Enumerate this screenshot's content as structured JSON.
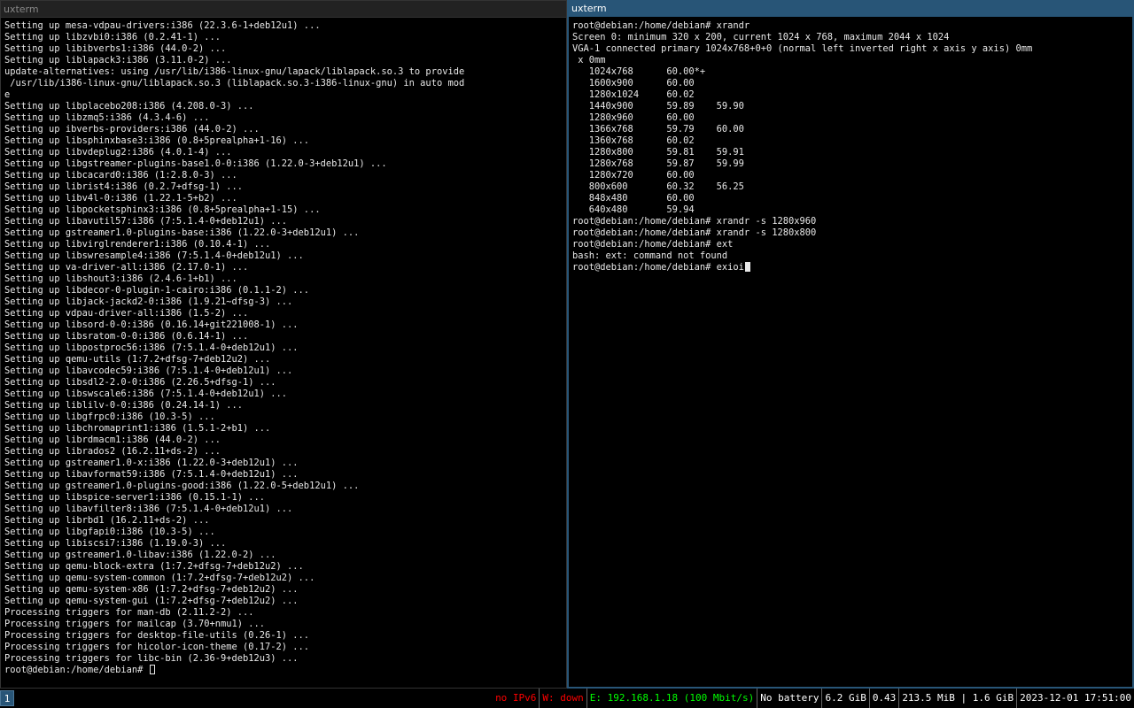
{
  "left_window": {
    "title": "uxterm",
    "lines": [
      "Setting up mesa-vdpau-drivers:i386 (22.3.6-1+deb12u1) ...",
      "Setting up libzvbi0:i386 (0.2.41-1) ...",
      "Setting up libibverbs1:i386 (44.0-2) ...",
      "Setting up liblapack3:i386 (3.11.0-2) ...",
      "update-alternatives: using /usr/lib/i386-linux-gnu/lapack/liblapack.so.3 to provide",
      " /usr/lib/i386-linux-gnu/liblapack.so.3 (liblapack.so.3-i386-linux-gnu) in auto mod",
      "e",
      "Setting up libplacebo208:i386 (4.208.0-3) ...",
      "Setting up libzmq5:i386 (4.3.4-6) ...",
      "Setting up ibverbs-providers:i386 (44.0-2) ...",
      "Setting up libsphinxbase3:i386 (0.8+5prealpha+1-16) ...",
      "Setting up libvdeplug2:i386 (4.0.1-4) ...",
      "Setting up libgstreamer-plugins-base1.0-0:i386 (1.22.0-3+deb12u1) ...",
      "Setting up libcacard0:i386 (1:2.8.0-3) ...",
      "Setting up librist4:i386 (0.2.7+dfsg-1) ...",
      "Setting up libv4l-0:i386 (1.22.1-5+b2) ...",
      "Setting up libpocketsphinx3:i386 (0.8+5prealpha+1-15) ...",
      "Setting up libavutil57:i386 (7:5.1.4-0+deb12u1) ...",
      "Setting up gstreamer1.0-plugins-base:i386 (1.22.0-3+deb12u1) ...",
      "Setting up libvirglrenderer1:i386 (0.10.4-1) ...",
      "Setting up libswresample4:i386 (7:5.1.4-0+deb12u1) ...",
      "Setting up va-driver-all:i386 (2.17.0-1) ...",
      "Setting up libshout3:i386 (2.4.6-1+b1) ...",
      "Setting up libdecor-0-plugin-1-cairo:i386 (0.1.1-2) ...",
      "Setting up libjack-jackd2-0:i386 (1.9.21~dfsg-3) ...",
      "Setting up vdpau-driver-all:i386 (1.5-2) ...",
      "Setting up libsord-0-0:i386 (0.16.14+git221008-1) ...",
      "Setting up libsratom-0-0:i386 (0.6.14-1) ...",
      "Setting up libpostproc56:i386 (7:5.1.4-0+deb12u1) ...",
      "Setting up qemu-utils (1:7.2+dfsg-7+deb12u2) ...",
      "Setting up libavcodec59:i386 (7:5.1.4-0+deb12u1) ...",
      "Setting up libsdl2-2.0-0:i386 (2.26.5+dfsg-1) ...",
      "Setting up libswscale6:i386 (7:5.1.4-0+deb12u1) ...",
      "Setting up liblilv-0-0:i386 (0.24.14-1) ...",
      "Setting up libgfrpc0:i386 (10.3-5) ...",
      "Setting up libchromaprint1:i386 (1.5.1-2+b1) ...",
      "Setting up librdmacm1:i386 (44.0-2) ...",
      "Setting up librados2 (16.2.11+ds-2) ...",
      "Setting up gstreamer1.0-x:i386 (1.22.0-3+deb12u1) ...",
      "Setting up libavformat59:i386 (7:5.1.4-0+deb12u1) ...",
      "Setting up gstreamer1.0-plugins-good:i386 (1.22.0-5+deb12u1) ...",
      "Setting up libspice-server1:i386 (0.15.1-1) ...",
      "Setting up libavfilter8:i386 (7:5.1.4-0+deb12u1) ...",
      "Setting up librbd1 (16.2.11+ds-2) ...",
      "Setting up libgfapi0:i386 (10.3-5) ...",
      "Setting up libiscsi7:i386 (1.19.0-3) ...",
      "Setting up gstreamer1.0-libav:i386 (1.22.0-2) ...",
      "Setting up qemu-block-extra (1:7.2+dfsg-7+deb12u2) ...",
      "Setting up qemu-system-common (1:7.2+dfsg-7+deb12u2) ...",
      "Setting up qemu-system-x86 (1:7.2+dfsg-7+deb12u2) ...",
      "Setting up qemu-system-gui (1:7.2+dfsg-7+deb12u2) ...",
      "Processing triggers for man-db (2.11.2-2) ...",
      "Processing triggers for mailcap (3.70+nmu1) ...",
      "Processing triggers for desktop-file-utils (0.26-1) ...",
      "Processing triggers for hicolor-icon-theme (0.17-2) ...",
      "Processing triggers for libc-bin (2.36-9+deb12u3) ..."
    ],
    "prompt": "root@debian:/home/debian# "
  },
  "right_window": {
    "title": "uxterm",
    "lines": [
      "root@debian:/home/debian# xrandr",
      "Screen 0: minimum 320 x 200, current 1024 x 768, maximum 2044 x 1024",
      "VGA-1 connected primary 1024x768+0+0 (normal left inverted right x axis y axis) 0mm",
      " x 0mm",
      "   1024x768      60.00*+",
      "   1600x900      60.00",
      "   1280x1024     60.02",
      "   1440x900      59.89    59.90",
      "   1280x960      60.00",
      "   1366x768      59.79    60.00",
      "   1360x768      60.02",
      "   1280x800      59.81    59.91",
      "   1280x768      59.87    59.99",
      "   1280x720      60.00",
      "   800x600       60.32    56.25",
      "   848x480       60.00",
      "   640x480       59.94",
      "root@debian:/home/debian# xrandr -s 1280x960",
      "root@debian:/home/debian# xrandr -s 1280x800",
      "root@debian:/home/debian# ext",
      "bash: ext: command not found"
    ],
    "prompt": "root@debian:/home/debian# exioi"
  },
  "bar": {
    "workspace": "1",
    "ipv6": "no IPv6",
    "wireless": "W: down",
    "ethernet": "E: 192.168.1.18 (100 Mbit/s)",
    "battery": "No battery",
    "disk": "6.2 GiB",
    "load": "0.43",
    "memory": "213.5 MiB | 1.6 GiB",
    "datetime": "2023-12-01 17:51:00",
    "colors": {
      "red": "#ff0000",
      "green": "#00ff00",
      "focused": "#285577"
    }
  }
}
